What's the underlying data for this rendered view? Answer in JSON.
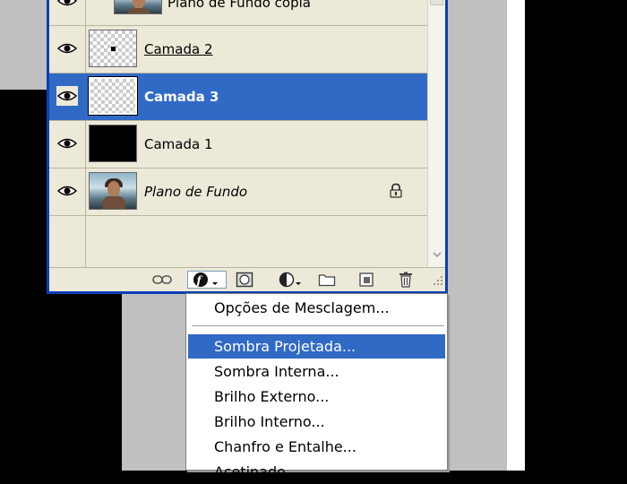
{
  "layers_panel": {
    "layers": [
      {
        "name": "Plano de Fundo cópia",
        "thumbnail": "photo",
        "visible": true,
        "linked_arrow": true
      },
      {
        "name": "Camada 2",
        "thumbnail": "transparent-dot",
        "visible": true,
        "underlined": true
      },
      {
        "name": "Camada 3",
        "thumbnail": "transparent",
        "visible": true,
        "selected": true
      },
      {
        "name": "Camada 1",
        "thumbnail": "black",
        "visible": true
      },
      {
        "name": "Plano de Fundo",
        "thumbnail": "photo",
        "visible": true,
        "italic": true,
        "locked": true
      }
    ],
    "toolbar_icons": [
      "link-icon",
      "layer-style-fx-icon",
      "layer-mask-icon",
      "adjustment-layer-icon",
      "new-group-folder-icon",
      "new-layer-icon",
      "trash-icon",
      "resize-grip-icon"
    ]
  },
  "layer_style_menu": {
    "items": [
      {
        "label": "Opções de Mesclagem..."
      },
      {
        "label": "Sombra Projetada...",
        "highlighted": true
      },
      {
        "label": "Sombra Interna..."
      },
      {
        "label": "Brilho Externo..."
      },
      {
        "label": "Brilho Interno..."
      },
      {
        "label": "Chanfro e Entalhe..."
      },
      {
        "label": "Acetinado..."
      }
    ]
  },
  "colors": {
    "selection": "#316ac5",
    "panel_bg": "#ece9d8",
    "panel_border": "#0b3fb5"
  }
}
